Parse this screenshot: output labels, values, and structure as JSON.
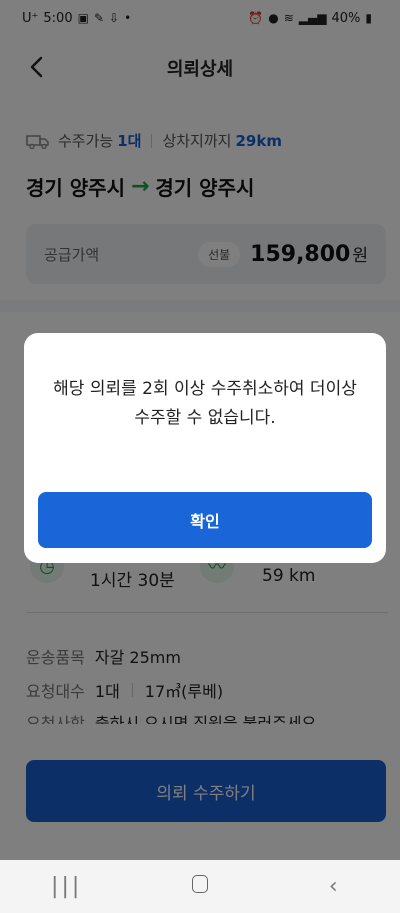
{
  "status_bar": {
    "time": "5:00",
    "carrier": "U⁺",
    "battery": "40%"
  },
  "header": {
    "title": "의뢰상세"
  },
  "summary": {
    "capacity_label": "수주가능",
    "capacity_value": "1대",
    "distance_label": "상차지까지",
    "distance_value": "29km",
    "route_from": "경기 양주시",
    "route_arrow": "→",
    "route_to": "경기 양주시",
    "price_label": "공급가액",
    "price_badge": "선불",
    "price_amount": "159,800",
    "price_unit": "원"
  },
  "trip": {
    "duration": "1시간 30분",
    "distance": "59 km"
  },
  "details": {
    "cargo_label": "운송품목",
    "cargo_value": "자갈 25mm",
    "request_label": "요청대수",
    "request_count": "1대",
    "request_volume": "17㎥(루베)",
    "note_label": "요청사항",
    "note_value": "출하시 오시면 직원을 불러주세요"
  },
  "cta": {
    "label": "의뢰 수주하기"
  },
  "dialog": {
    "message_line1": "해당 의뢰를 2회 이상 수주취소하여 더이상",
    "message_line2": "수주할 수 없습니다.",
    "confirm_label": "확인"
  },
  "colors": {
    "accent": "#1a5fd0",
    "route_arrow": "#1aa24a",
    "dialog_button": "#1a66d9"
  }
}
